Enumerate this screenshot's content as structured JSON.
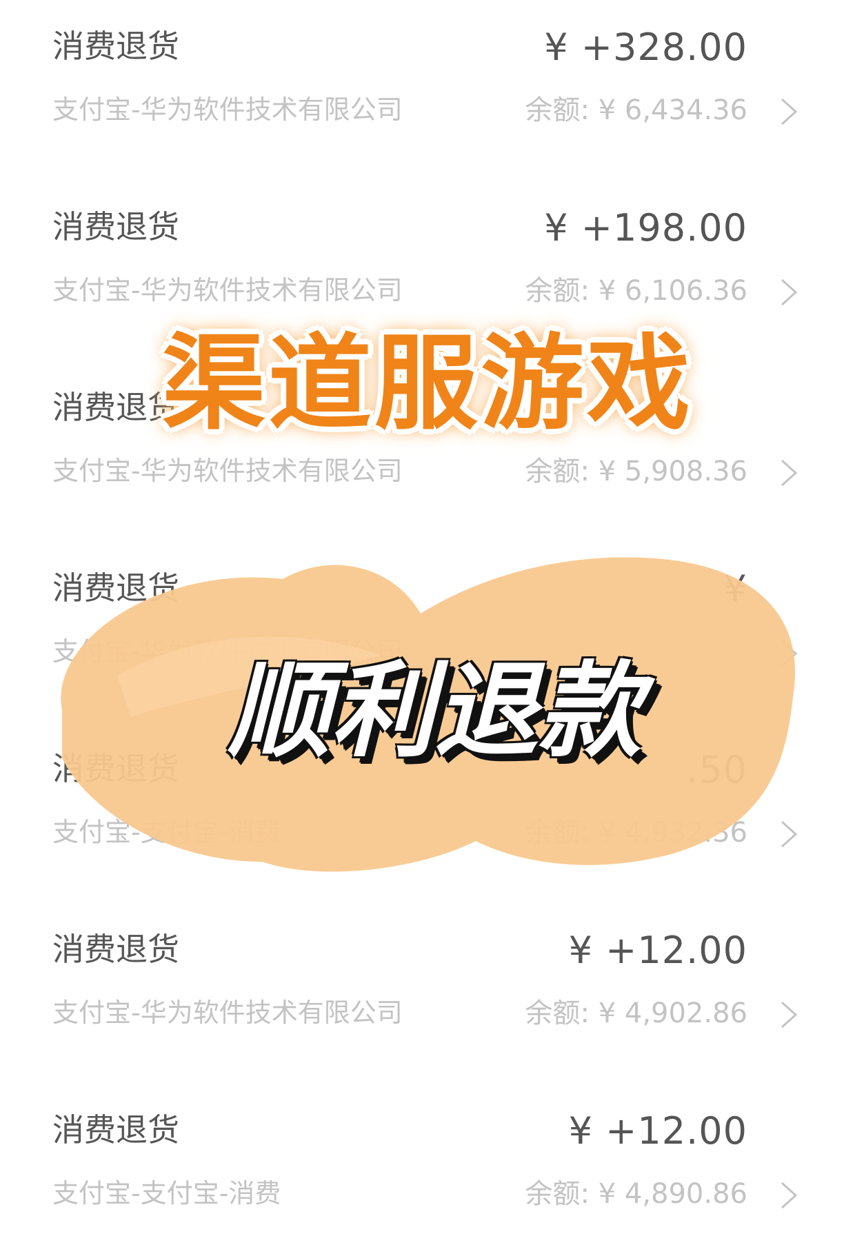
{
  "transactions": [
    {
      "title": "消费退货",
      "amount": "¥ +328.00",
      "source": "支付宝-华为软件技术有限公司",
      "balance": "余额: ¥ 6,434.36"
    },
    {
      "title": "消费退货",
      "amount": "¥ +198.00",
      "source": "支付宝-华为软件技术有限公司",
      "balance": "余额: ¥ 6,106.36"
    },
    {
      "title": "消费退货",
      "amount": "",
      "source": "支付宝-华为软件技术有限公司",
      "balance": "余额: ¥ 5,908.36"
    },
    {
      "title": "消费退货",
      "amount": "¥",
      "source": "支付宝-华为软件技术有限公司",
      "balance": ""
    },
    {
      "title": "消费退货",
      "amount": ".50",
      "source": "支付宝-支付宝-消费",
      "balance": "余额: ¥ 4,932.36"
    },
    {
      "title": "消费退货",
      "amount": "¥ +12.00",
      "source": "支付宝-华为软件技术有限公司",
      "balance": "余额: ¥ 4,902.86"
    },
    {
      "title": "消费退货",
      "amount": "¥ +12.00",
      "source": "支付宝-支付宝-消费",
      "balance": "余额: ¥ 4,890.86"
    }
  ],
  "overlay": {
    "headline": "渠道服游戏",
    "subline": "顺利退款"
  },
  "colors": {
    "title_text": "#555555",
    "secondary_text": "#c3c3c3",
    "headline_orange": "#f08418",
    "blob_peach": "#f9c88e"
  },
  "icons": {
    "row_arrow": "chevron-right-icon"
  }
}
